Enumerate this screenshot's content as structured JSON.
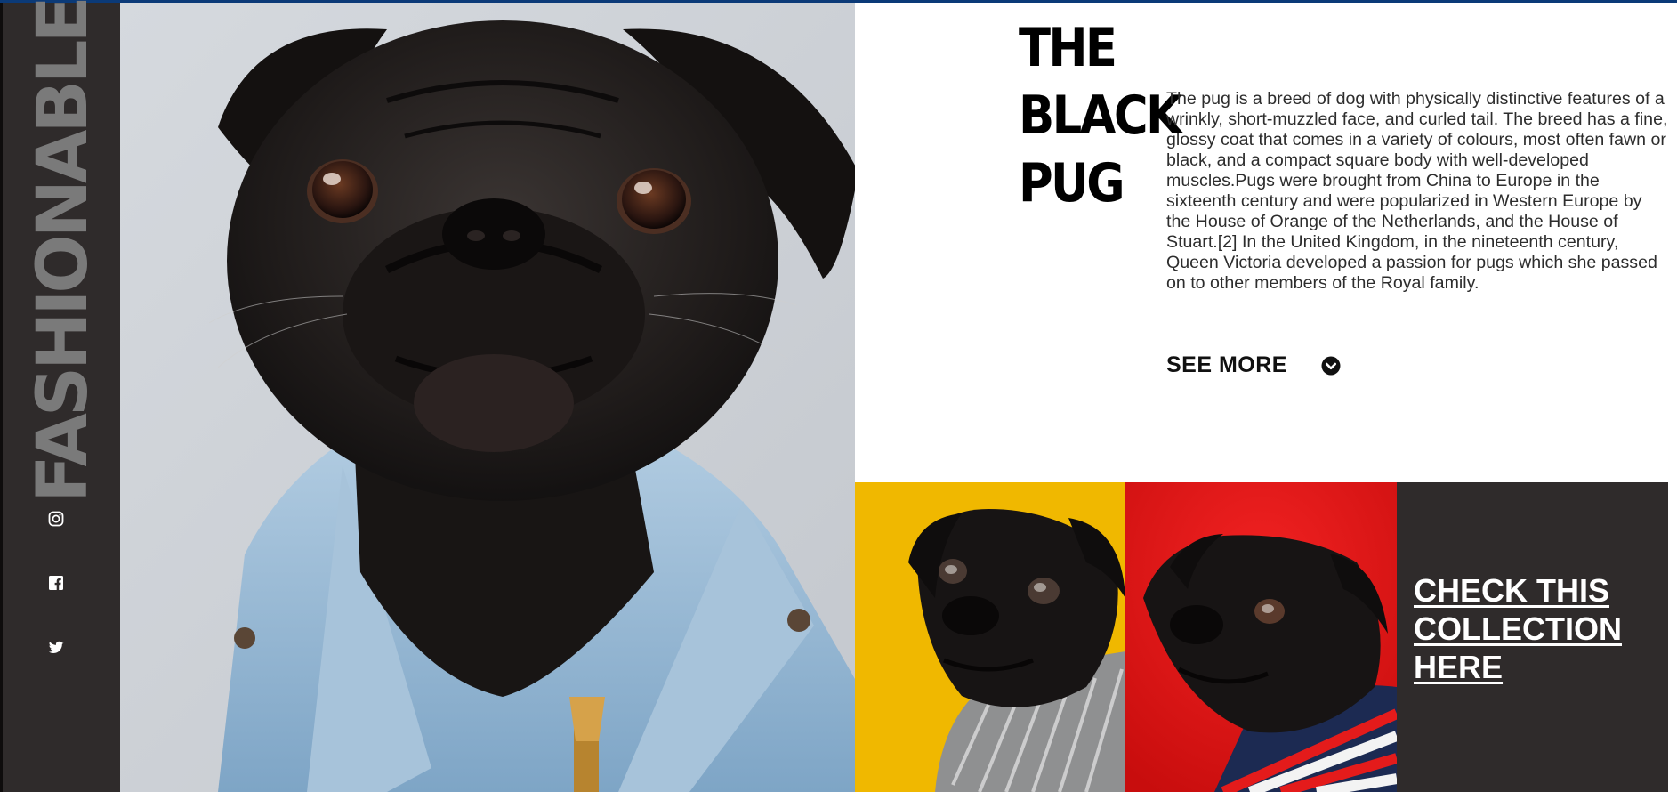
{
  "brand": {
    "wordmark": "FASHIONABLE"
  },
  "social": [
    {
      "name": "instagram-icon"
    },
    {
      "name": "facebook-icon"
    },
    {
      "name": "twitter-icon"
    }
  ],
  "hero": {
    "image": "black pug in denim jacket"
  },
  "article": {
    "title_line1": "THE BLACK",
    "title_line2": "PUG",
    "description": "The pug is a breed of dog with physically distinctive features of a wrinkly, short-muzzled face, and curled tail. The breed has a fine, glossy coat that comes in a variety of colours, most often fawn or black, and a compact square body with well-developed muscles.Pugs were brought from China to Europe in the sixteenth century and were popularized in Western Europe by the House of Orange of the Netherlands, and the House of Stuart.[2] In the United Kingdom, in the nineteenth century, Queen Victoria developed a passion for pugs which she passed on to other members of the Royal family.",
    "see_more_label": "SEE MORE",
    "see_more_icon": "chevron-down-circle-icon"
  },
  "collection": {
    "tiles": [
      {
        "image": "pug in knit scarf",
        "background": "#f0b800"
      },
      {
        "image": "pug in striped sweater",
        "background": "#e01212"
      }
    ],
    "cta_label": "CHECK THIS COLLECTION HERE"
  },
  "colors": {
    "sidebar": "#2f2b2b",
    "wordmark": "#7a7a7a",
    "accent_rule": "#0b3a78",
    "cta_panel": "#2f2b2b"
  }
}
